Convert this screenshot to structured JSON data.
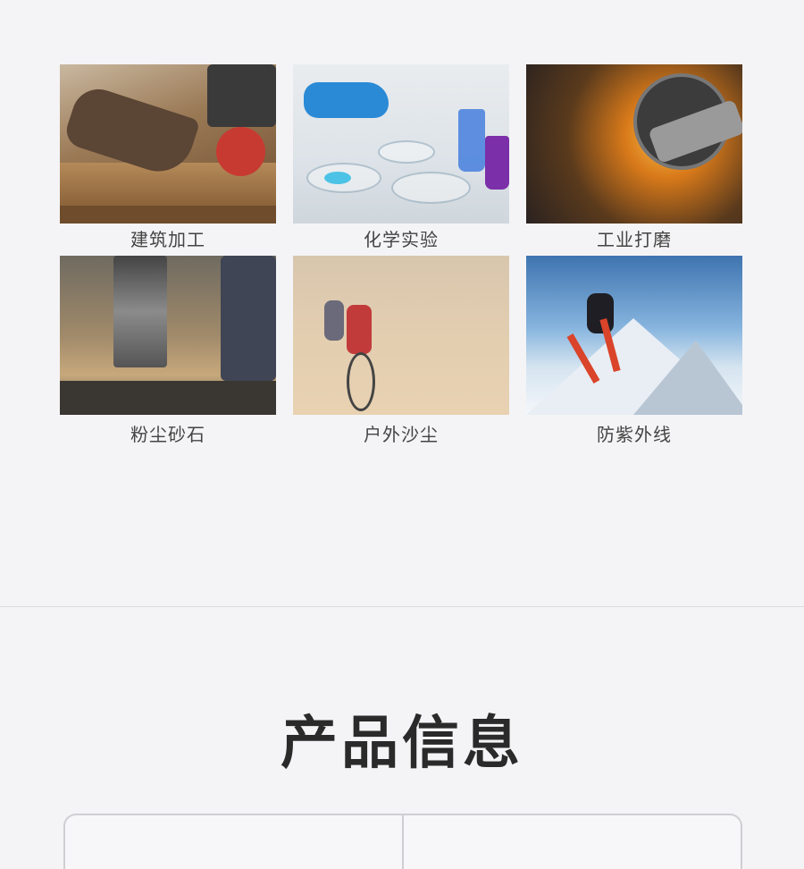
{
  "scenarios": [
    {
      "label": "建筑加工",
      "image": "construction-woodworking"
    },
    {
      "label": "化学实验",
      "image": "chemistry-lab"
    },
    {
      "label": "工业打磨",
      "image": "industrial-grinding"
    },
    {
      "label": "粉尘砂石",
      "image": "dust-gravel"
    },
    {
      "label": "户外沙尘",
      "image": "outdoor-sandstorm"
    },
    {
      "label": "防紫外线",
      "image": "uv-protection-skiing"
    }
  ],
  "section": {
    "title": "产品信息"
  },
  "table": {
    "cells": [
      "",
      ""
    ]
  }
}
